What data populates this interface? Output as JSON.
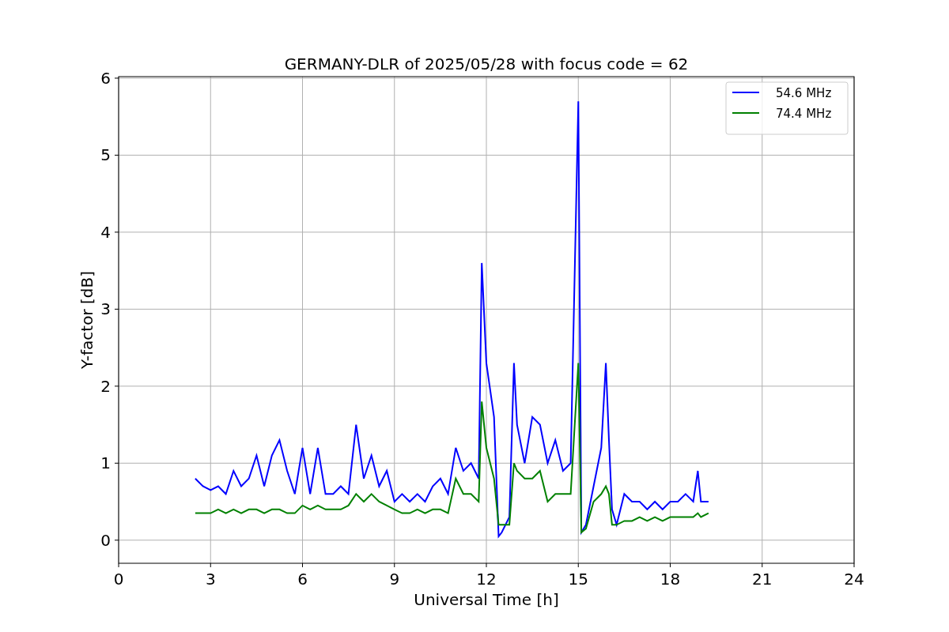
{
  "chart": {
    "chart_data": {
      "type": "line",
      "title": "GERMANY-DLR of 2025/05/28 with focus code = 62",
      "xlabel": "Universal Time [h]",
      "ylabel": "Y-factor [dB]",
      "x": [
        2.5,
        2.75,
        3.0,
        3.25,
        3.5,
        3.75,
        4.0,
        4.25,
        4.5,
        4.75,
        5.0,
        5.25,
        5.5,
        5.75,
        6.0,
        6.25,
        6.5,
        6.75,
        7.0,
        7.25,
        7.5,
        7.75,
        8.0,
        8.25,
        8.5,
        8.75,
        9.0,
        9.25,
        9.5,
        9.75,
        10.0,
        10.25,
        10.5,
        10.75,
        11.0,
        11.25,
        11.5,
        11.75,
        11.85,
        12.0,
        12.25,
        12.4,
        12.5,
        12.75,
        12.9,
        13.0,
        13.25,
        13.5,
        13.75,
        14.0,
        14.25,
        14.5,
        14.75,
        15.0,
        15.1,
        15.25,
        15.5,
        15.75,
        15.9,
        16.0,
        16.1,
        16.25,
        16.5,
        16.75,
        17.0,
        17.25,
        17.5,
        17.75,
        18.0,
        18.25,
        18.5,
        18.75,
        18.9,
        19.0,
        19.25
      ],
      "series": [
        {
          "name": "54.6 MHz",
          "color": "#0000ff",
          "values": [
            0.8,
            0.7,
            0.65,
            0.7,
            0.6,
            0.9,
            0.7,
            0.8,
            1.1,
            0.7,
            1.1,
            1.3,
            0.9,
            0.6,
            1.2,
            0.6,
            1.2,
            0.6,
            0.6,
            0.7,
            0.6,
            1.5,
            0.8,
            1.1,
            0.7,
            0.9,
            0.5,
            0.6,
            0.5,
            0.6,
            0.5,
            0.7,
            0.8,
            0.6,
            1.2,
            0.9,
            1.0,
            0.8,
            3.6,
            2.3,
            1.6,
            0.05,
            0.1,
            0.3,
            2.3,
            1.5,
            1.0,
            1.6,
            1.5,
            1.0,
            1.3,
            0.9,
            1.0,
            5.7,
            0.1,
            0.2,
            0.7,
            1.2,
            2.3,
            1.3,
            0.4,
            0.2,
            0.6,
            0.5,
            0.5,
            0.4,
            0.5,
            0.4,
            0.5,
            0.5,
            0.6,
            0.5,
            0.9,
            0.5,
            0.5
          ]
        },
        {
          "name": "74.4 MHz",
          "color": "#008000",
          "values": [
            0.35,
            0.35,
            0.35,
            0.4,
            0.35,
            0.4,
            0.35,
            0.4,
            0.4,
            0.35,
            0.4,
            0.4,
            0.35,
            0.35,
            0.45,
            0.4,
            0.45,
            0.4,
            0.4,
            0.4,
            0.45,
            0.6,
            0.5,
            0.6,
            0.5,
            0.45,
            0.4,
            0.35,
            0.35,
            0.4,
            0.35,
            0.4,
            0.4,
            0.35,
            0.8,
            0.6,
            0.6,
            0.5,
            1.8,
            1.2,
            0.8,
            0.2,
            0.2,
            0.2,
            1.0,
            0.9,
            0.8,
            0.8,
            0.9,
            0.5,
            0.6,
            0.6,
            0.6,
            2.3,
            0.1,
            0.15,
            0.5,
            0.6,
            0.7,
            0.6,
            0.2,
            0.2,
            0.25,
            0.25,
            0.3,
            0.25,
            0.3,
            0.25,
            0.3,
            0.3,
            0.3,
            0.3,
            0.35,
            0.3,
            0.35
          ]
        }
      ],
      "grid": true,
      "legend": true,
      "xlim": [
        0,
        24
      ],
      "ylim": [
        -0.3,
        6.02
      ],
      "xticks": [
        0,
        3,
        6,
        9,
        12,
        15,
        18,
        21,
        24
      ],
      "yticks": [
        0,
        1,
        2,
        3,
        4,
        5,
        6
      ]
    }
  }
}
